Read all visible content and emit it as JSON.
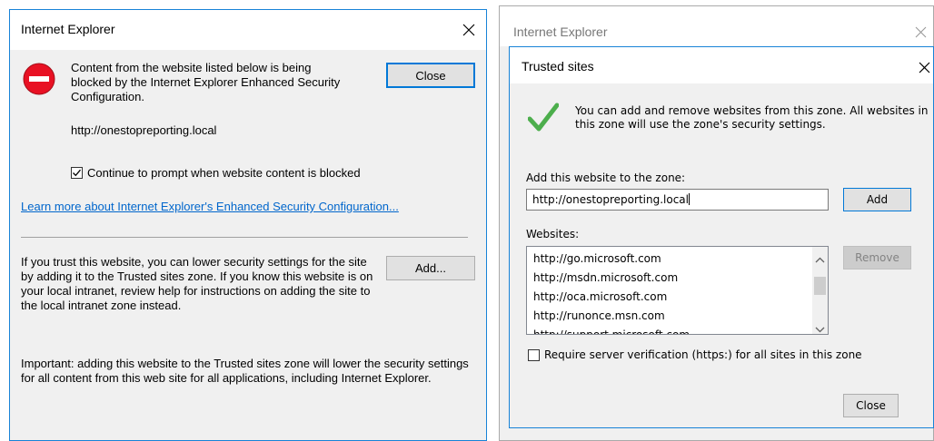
{
  "ie_dialog": {
    "title": "Internet Explorer",
    "message": "Content from the website listed below is being blocked by the Internet Explorer Enhanced Security Configuration.",
    "url": "http://onestopreporting.local",
    "checkbox_label": "Continue to prompt when website content is blocked",
    "checkbox_checked": true,
    "learn_more_link": "Learn more about Internet Explorer's Enhanced Security Configuration...",
    "trust_text": "If you trust this website, you can lower security settings for the site by adding it to the Trusted sites zone. If you know this website is on your local intranet, review help for instructions on adding the site to the local intranet zone instead.",
    "important_text": "Important: adding this website to the Trusted sites zone will lower the security settings for all content from this web site for all applications, including Internet Explorer.",
    "close_label": "Close",
    "add_label": "Add...",
    "icon": "error-stop-icon"
  },
  "ie_background_window": {
    "title": "Internet Explorer"
  },
  "trusted_sites": {
    "title": "Trusted sites",
    "info_text": "You can add and remove websites from this zone. All websites in this zone will use the zone's security settings.",
    "add_label": "Add this website to the zone:",
    "add_value": "http://onestopreporting.local",
    "add_button": "Add",
    "websites_label": "Websites:",
    "websites": [
      "http://go.microsoft.com",
      "http://msdn.microsoft.com",
      "http://oca.microsoft.com",
      "http://runonce.msn.com",
      "http://support.microsoft.com"
    ],
    "remove_button": "Remove",
    "require_verification_label": "Require server verification (https:) for all sites in this zone",
    "require_verification_checked": false,
    "close_button": "Close",
    "icon": "checkmark-icon"
  },
  "colors": {
    "accent": "#0078d7",
    "dialog_bg": "#f0f0f0",
    "link": "#0066cc",
    "stop_red": "#e81123",
    "check_green": "#5cb85c"
  }
}
